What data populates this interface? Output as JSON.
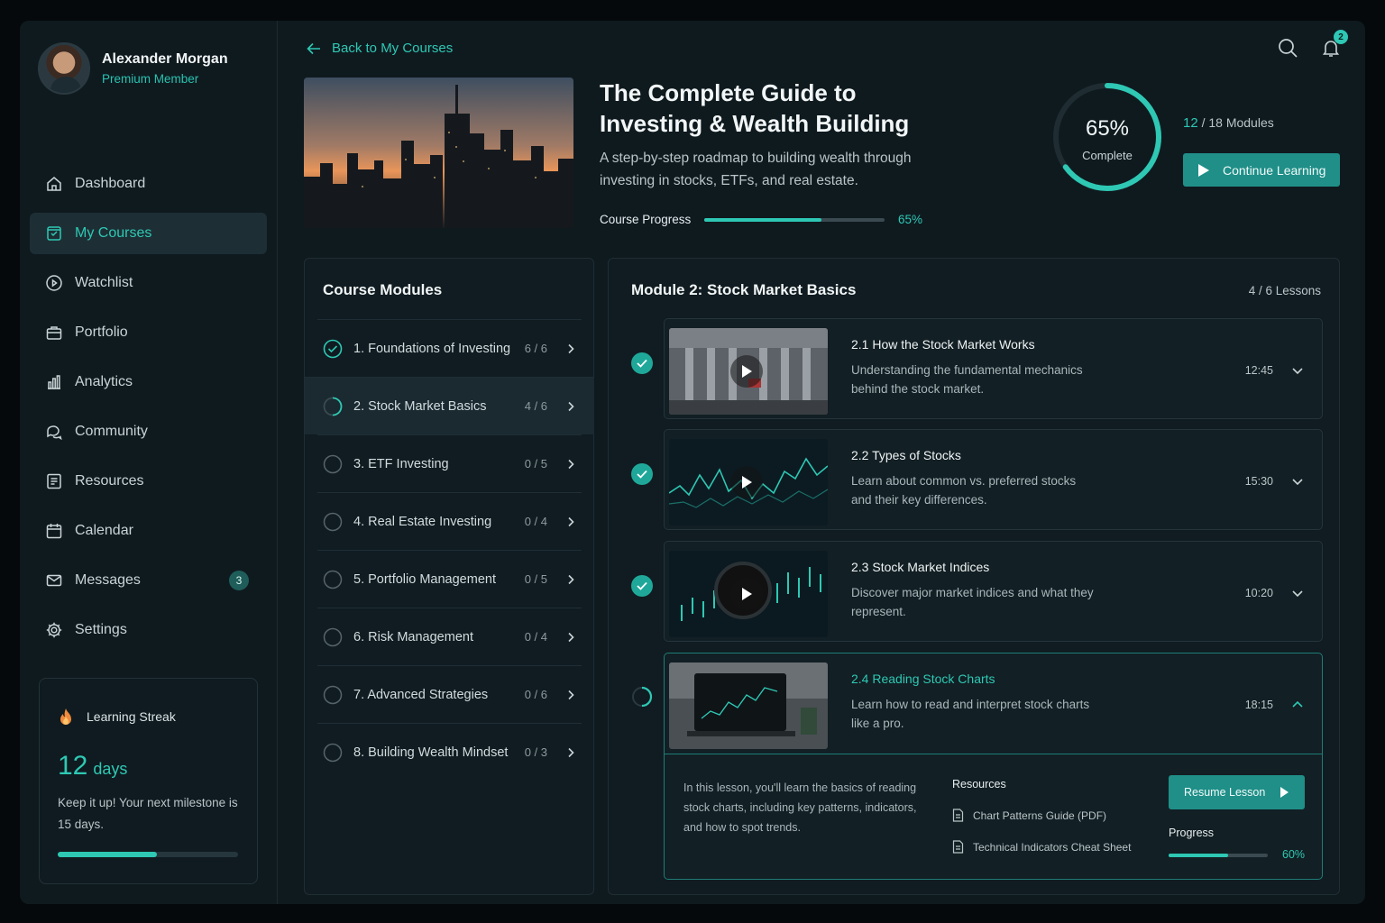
{
  "profile": {
    "name": "Alexander Morgan",
    "role": "Premium Member"
  },
  "nav": [
    {
      "label": "Dashboard",
      "icon": "home-icon"
    },
    {
      "label": "My Courses",
      "icon": "courses-icon",
      "active": true
    },
    {
      "label": "Watchlist",
      "icon": "play-circle-icon"
    },
    {
      "label": "Portfolio",
      "icon": "briefcase-icon"
    },
    {
      "label": "Analytics",
      "icon": "bar-chart-icon"
    },
    {
      "label": "Community",
      "icon": "chat-icon"
    },
    {
      "label": "Resources",
      "icon": "document-icon"
    },
    {
      "label": "Calendar",
      "icon": "calendar-icon"
    },
    {
      "label": "Messages",
      "icon": "mail-icon",
      "badge": "3"
    },
    {
      "label": "Settings",
      "icon": "gear-icon"
    }
  ],
  "streak": {
    "title": "Learning Streak",
    "value": "12",
    "unit": "days",
    "message": "Keep it up! Your next milestone is 15 days.",
    "progress": 0.55
  },
  "header": {
    "back_label": "Back to My Courses",
    "notification_count": "2"
  },
  "course": {
    "title": "The Complete Guide to Investing & Wealth Building",
    "description": "A step-by-step roadmap to building wealth through investing in stocks, ETFs, and real estate.",
    "progress_label": "Course Progress",
    "progress_pct": "65%",
    "progress": 0.65,
    "ring_pct": "65%",
    "ring_label": "Complete",
    "modules_done": "12",
    "modules_total": " / 18 Modules",
    "continue_label": "Continue Learning"
  },
  "modules_panel": {
    "title": "Course Modules",
    "items": [
      {
        "label": "1. Foundations of Investing",
        "count": "6 / 6",
        "status": "done"
      },
      {
        "label": "2. Stock Market Basics",
        "count": "4 / 6",
        "status": "progress",
        "active": true
      },
      {
        "label": "3. ETF Investing",
        "count": "0 / 5",
        "status": "todo"
      },
      {
        "label": "4. Real Estate Investing",
        "count": "0 / 4",
        "status": "todo"
      },
      {
        "label": "5. Portfolio Management",
        "count": "0 / 5",
        "status": "todo"
      },
      {
        "label": "6. Risk Management",
        "count": "0 / 4",
        "status": "todo"
      },
      {
        "label": "7. Advanced Strategies",
        "count": "0 / 6",
        "status": "todo"
      },
      {
        "label": "8. Building Wealth Mindset",
        "count": "0 / 3",
        "status": "todo"
      }
    ]
  },
  "lessons_panel": {
    "title": "Module 2: Stock Market Basics",
    "count": "4 / 6 Lessons",
    "items": [
      {
        "title": "2.1  How the Stock Market Works",
        "desc": "Understanding the fundamental mechanics behind the stock market.",
        "duration": "12:45",
        "status": "done"
      },
      {
        "title": "2.2  Types of Stocks",
        "desc": "Learn about common vs. preferred stocks and their key differences.",
        "duration": "15:30",
        "status": "done"
      },
      {
        "title": "2.3  Stock Market Indices",
        "desc": "Discover major market indices and what they represent.",
        "duration": "10:20",
        "status": "done"
      },
      {
        "title": "2.4  Reading Stock Charts",
        "desc": "Learn how to read and interpret stock charts like a pro.",
        "duration": "18:15",
        "status": "progress"
      }
    ],
    "expanded": {
      "description": "In this lesson, you'll learn the basics of reading stock charts, including key patterns, indicators, and how to spot trends.",
      "resources_title": "Resources",
      "resources": [
        "Chart Patterns Guide (PDF)",
        "Technical Indicators Cheat Sheet"
      ],
      "resume_label": "Resume Lesson",
      "progress_label": "Progress",
      "progress_pct": "60%",
      "progress": 0.6
    }
  },
  "colors": {
    "accent": "#2ec8b4",
    "button": "#1f8f88",
    "background": "#0f1a1f"
  }
}
